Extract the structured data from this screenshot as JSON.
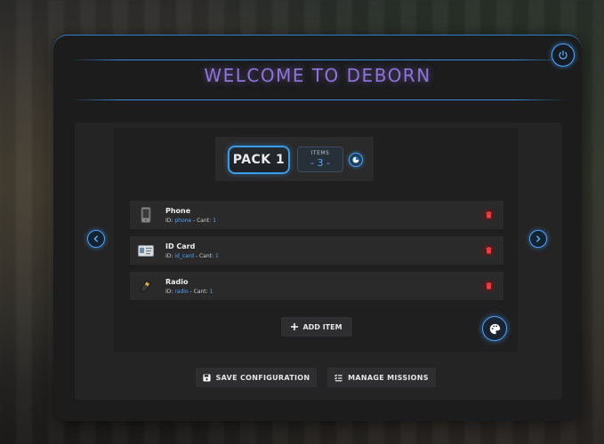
{
  "header": {
    "title": "WELCOME TO DEBORN"
  },
  "pack": {
    "label": "PACK 1",
    "items_label": "ITEMS",
    "items_count": "- 3 -"
  },
  "items": [
    {
      "name": "Phone",
      "id_label": "ID:",
      "id": "phone",
      "cant_label": "- Cant:",
      "cant": "1",
      "icon": "phone-icon"
    },
    {
      "name": "ID Card",
      "id_label": "ID:",
      "id": "id_card",
      "cant_label": "- Cant:",
      "cant": "1",
      "icon": "id-card-icon"
    },
    {
      "name": "Radio",
      "id_label": "ID:",
      "id": "radio",
      "cant_label": "- Cant:",
      "cant": "1",
      "icon": "radio-icon"
    }
  ],
  "buttons": {
    "add_item": "ADD ITEM",
    "save_configuration": "SAVE CONFIGURATION",
    "manage_missions": "MANAGE MISSIONS"
  },
  "colors": {
    "accent": "#4aa3ff",
    "title": "#8f74d8",
    "delete": "#e03a3e"
  }
}
